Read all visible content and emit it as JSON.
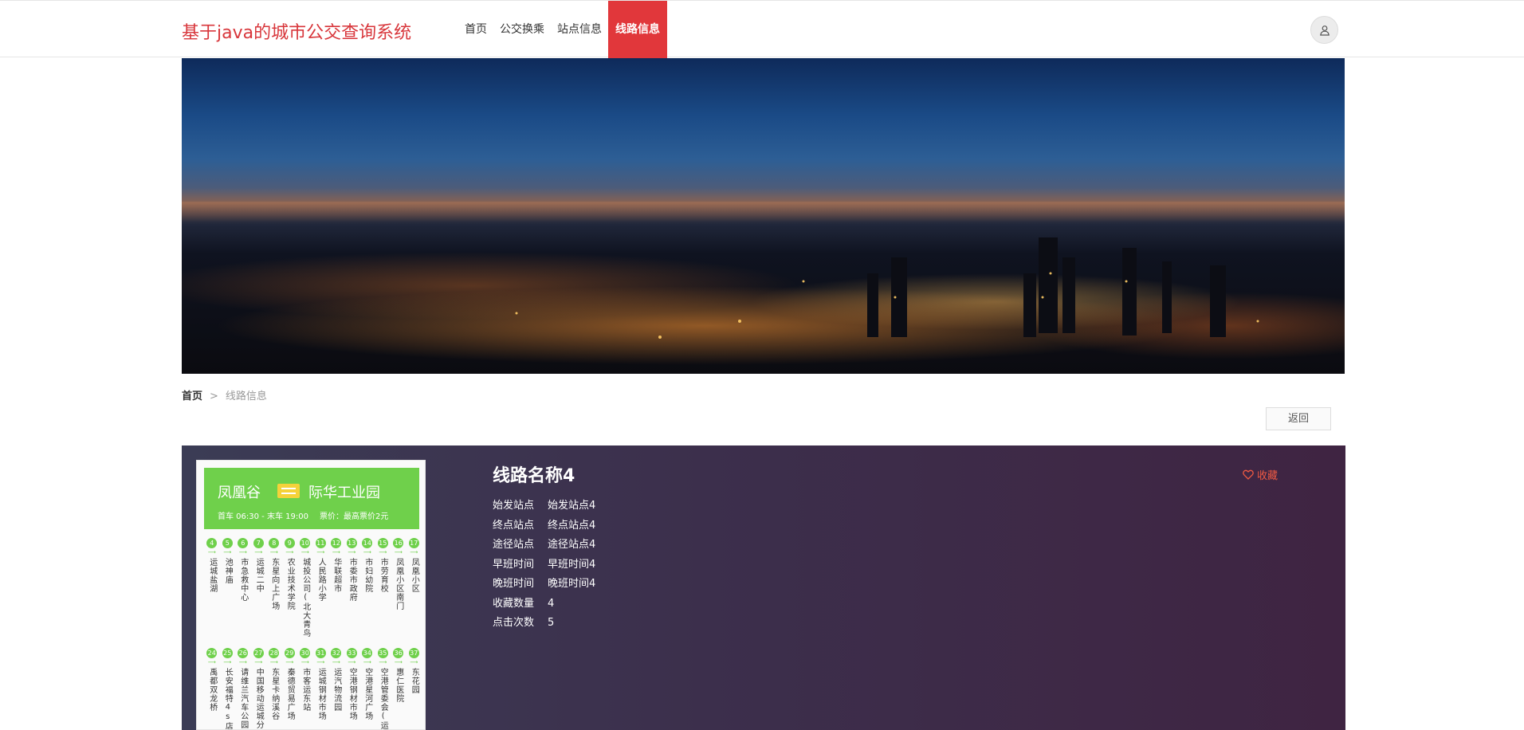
{
  "header": {
    "site_title": "基于java的城市公交查询系统",
    "nav": [
      {
        "label": "首页",
        "active": false
      },
      {
        "label": "公交换乘",
        "active": false
      },
      {
        "label": "站点信息",
        "active": false
      },
      {
        "label": "线路信息",
        "active": true
      }
    ],
    "avatar_icon": "user-icon"
  },
  "breadcrumb": {
    "home": "首页",
    "separator": ">",
    "current": "线路信息"
  },
  "back_button": "返回",
  "detail": {
    "title": "线路名称4",
    "favorite_label": "收藏",
    "fields": [
      {
        "label": "始发站点",
        "value": "始发站点4"
      },
      {
        "label": "终点站点",
        "value": "终点站点4"
      },
      {
        "label": "途径站点",
        "value": "途径站点4"
      },
      {
        "label": "早班时间",
        "value": "早班时间4"
      },
      {
        "label": "晚班时间",
        "value": "晚班时间4"
      },
      {
        "label": "收藏数量",
        "value": "4"
      },
      {
        "label": "点击次数",
        "value": "5"
      }
    ],
    "route_image": {
      "from": "凤凰谷",
      "to": "际华工业园",
      "times": "首车 06:30 - 末车 19:00",
      "fare": "票价：最高票价2元",
      "stops_row1": [
        {
          "num": "4",
          "name": "运城盐湖"
        },
        {
          "num": "5",
          "name": "池神庙"
        },
        {
          "num": "6",
          "name": "市急救中心"
        },
        {
          "num": "7",
          "name": "运城二中"
        },
        {
          "num": "8",
          "name": "东星向上广场"
        },
        {
          "num": "9",
          "name": "农业技术学院"
        },
        {
          "num": "10",
          "name": "城投公司(北大青鸟"
        },
        {
          "num": "11",
          "name": "人民路小学"
        },
        {
          "num": "12",
          "name": "华联超市"
        },
        {
          "num": "13",
          "name": "市委市政府"
        },
        {
          "num": "14",
          "name": "市妇幼院"
        },
        {
          "num": "15",
          "name": "市劳育校"
        },
        {
          "num": "16",
          "name": "凤凰小区南门"
        },
        {
          "num": "17",
          "name": "凤凰小区"
        }
      ],
      "stops_row2": [
        {
          "num": "24",
          "name": "禹都双龙桥"
        },
        {
          "num": "25",
          "name": "长安福特4s店"
        },
        {
          "num": "26",
          "name": "请维兰汽车公园"
        },
        {
          "num": "27",
          "name": "中国移动运城分"
        },
        {
          "num": "28",
          "name": "东星卡纳溪谷"
        },
        {
          "num": "29",
          "name": "秦德贸易广场"
        },
        {
          "num": "30",
          "name": "市客运东站"
        },
        {
          "num": "31",
          "name": "运城钢材市场"
        },
        {
          "num": "32",
          "name": "运汽物流园"
        },
        {
          "num": "33",
          "name": "空港钢材市场"
        },
        {
          "num": "34",
          "name": "空港星河广场"
        },
        {
          "num": "35",
          "name": "空港管委会(运"
        },
        {
          "num": "36",
          "name": "惠仁医院"
        },
        {
          "num": "37",
          "name": "东花园"
        }
      ]
    }
  }
}
